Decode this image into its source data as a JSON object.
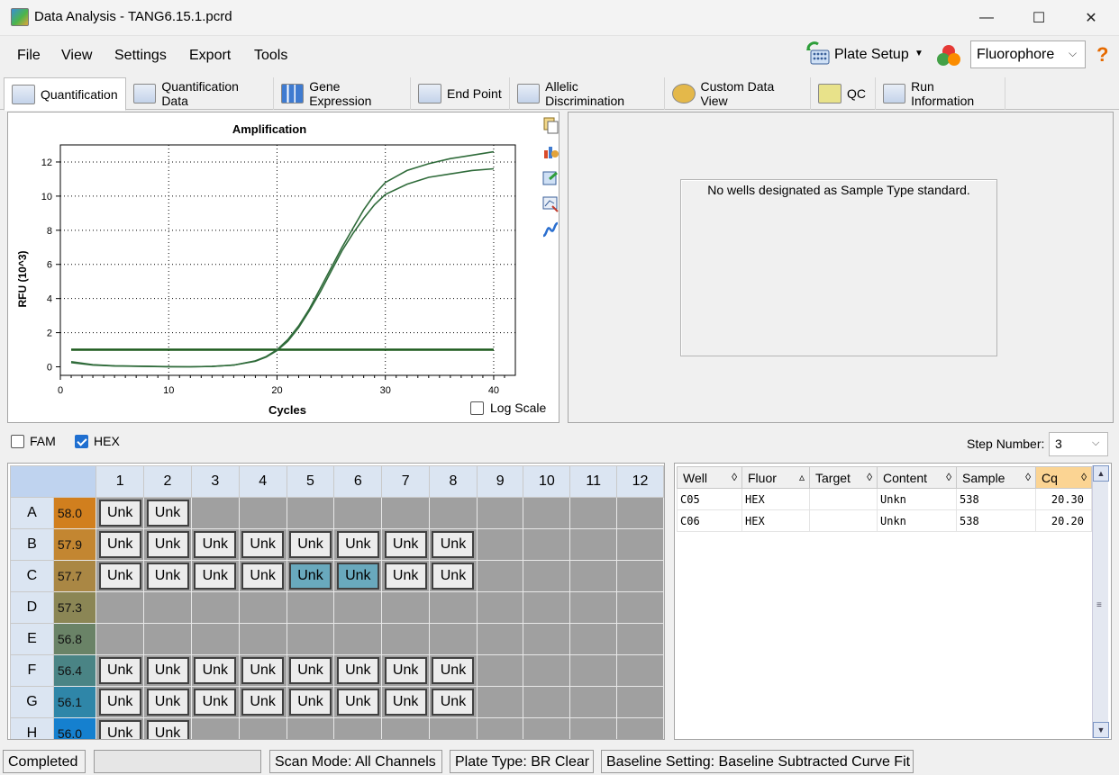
{
  "window": {
    "title": "Data Analysis - TANG6.15.1.pcrd",
    "minimize": "—",
    "maximize": "☐",
    "close": "✕"
  },
  "menu": {
    "file": "File",
    "view": "View",
    "settings": "Settings",
    "export": "Export",
    "tools": "Tools"
  },
  "toolbar": {
    "plate_setup": "Plate Setup",
    "fluorophore": "Fluorophore",
    "help": "?"
  },
  "tabs": [
    "Quantification",
    "Quantification Data",
    "Gene Expression",
    "End Point",
    "Allelic Discrimination",
    "Custom Data View",
    "QC",
    "Run Information"
  ],
  "standard_panel": {
    "message": "No wells designated as Sample Type standard."
  },
  "log_scale": "Log Scale",
  "fluors": {
    "fam": "FAM",
    "hex": "HEX"
  },
  "step": {
    "label": "Step Number:",
    "value": "3"
  },
  "plate": {
    "columns": [
      "1",
      "2",
      "3",
      "4",
      "5",
      "6",
      "7",
      "8",
      "9",
      "10",
      "11",
      "12"
    ],
    "rows": [
      {
        "label": "A",
        "temp": "58.0",
        "color": "#d17f1e",
        "wells": [
          "Unk",
          "Unk",
          "",
          "",
          "",
          "",
          "",
          "",
          "",
          "",
          "",
          ""
        ]
      },
      {
        "label": "B",
        "temp": "57.9",
        "color": "#c38631",
        "wells": [
          "Unk",
          "Unk",
          "Unk",
          "Unk",
          "Unk",
          "Unk",
          "Unk",
          "Unk",
          "",
          "",
          "",
          ""
        ]
      },
      {
        "label": "C",
        "temp": "57.7",
        "color": "#aa8744",
        "wells": [
          "Unk",
          "Unk",
          "Unk",
          "Unk",
          "Unk",
          "Unk",
          "Unk",
          "Unk",
          "",
          "",
          "",
          ""
        ]
      },
      {
        "label": "D",
        "temp": "57.3",
        "color": "#8b8655",
        "wells": [
          "",
          "",
          "",
          "",
          "",
          "",
          "",
          "",
          "",
          "",
          "",
          ""
        ]
      },
      {
        "label": "E",
        "temp": "56.8",
        "color": "#6a8367",
        "wells": [
          "",
          "",
          "",
          "",
          "",
          "",
          "",
          "",
          "",
          "",
          "",
          ""
        ]
      },
      {
        "label": "F",
        "temp": "56.4",
        "color": "#4a8485",
        "wells": [
          "Unk",
          "Unk",
          "Unk",
          "Unk",
          "Unk",
          "Unk",
          "Unk",
          "Unk",
          "",
          "",
          "",
          ""
        ]
      },
      {
        "label": "G",
        "temp": "56.1",
        "color": "#2f86a8",
        "wells": [
          "Unk",
          "Unk",
          "Unk",
          "Unk",
          "Unk",
          "Unk",
          "Unk",
          "Unk",
          "",
          "",
          "",
          ""
        ]
      },
      {
        "label": "H",
        "temp": "56.0",
        "color": "#1580cf",
        "wells": [
          "Unk",
          "Unk",
          "",
          "",
          "",
          "",
          "",
          "",
          "",
          "",
          "",
          ""
        ]
      }
    ],
    "selected": [
      "C5",
      "C6"
    ]
  },
  "well_table": {
    "headers": [
      "Well",
      "Fluor",
      "Target",
      "Content",
      "Sample",
      "Cq"
    ],
    "rows": [
      [
        "C05",
        "HEX",
        "",
        "Unkn",
        "538",
        "20.30"
      ],
      [
        "C06",
        "HEX",
        "",
        "Unkn",
        "538",
        "20.20"
      ]
    ]
  },
  "status": {
    "state": "Completed",
    "scan_mode": "Scan Mode: All Channels",
    "plate_type": "Plate Type: BR Clear",
    "baseline": "Baseline Setting: Baseline Subtracted Curve Fit"
  },
  "chart_data": {
    "type": "line",
    "title": "Amplification",
    "xlabel": "Cycles",
    "ylabel": "RFU (10^3)",
    "xlim": [
      0,
      42
    ],
    "ylim": [
      -0.5,
      13
    ],
    "xticks": [
      0,
      10,
      20,
      30,
      40
    ],
    "yticks": [
      0,
      2,
      4,
      6,
      8,
      10,
      12
    ],
    "grid": true,
    "threshold": 1.0,
    "series": [
      {
        "x": [
          1,
          3,
          5,
          8,
          10,
          12,
          14,
          16,
          18,
          19,
          20,
          21,
          22,
          23,
          24,
          25,
          26,
          27,
          28,
          29,
          30,
          32,
          34,
          36,
          38,
          40
        ],
        "y": [
          0.25,
          0.1,
          0.05,
          0.02,
          0.0,
          0.0,
          0.02,
          0.1,
          0.35,
          0.6,
          1.0,
          1.6,
          2.4,
          3.4,
          4.6,
          5.8,
          7.0,
          8.1,
          9.2,
          10.1,
          10.8,
          11.5,
          11.9,
          12.2,
          12.4,
          12.6
        ]
      },
      {
        "x": [
          1,
          3,
          5,
          8,
          10,
          12,
          14,
          16,
          18,
          19,
          20,
          21,
          22,
          23,
          24,
          25,
          26,
          27,
          28,
          29,
          30,
          32,
          34,
          36,
          38,
          40
        ],
        "y": [
          0.3,
          0.12,
          0.06,
          0.03,
          0.01,
          0.0,
          0.02,
          0.1,
          0.33,
          0.57,
          0.95,
          1.5,
          2.3,
          3.3,
          4.4,
          5.6,
          6.8,
          7.8,
          8.7,
          9.5,
          10.1,
          10.7,
          11.1,
          11.3,
          11.5,
          11.6
        ]
      }
    ]
  }
}
